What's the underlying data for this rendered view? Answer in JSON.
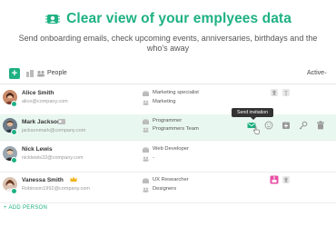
{
  "hero": {
    "title": "Clear view of your emplyees data",
    "subtitle": "Send onboarding emails, check upcoming events, anniversaries, birthdays and the who's away"
  },
  "toolbar": {
    "add_label": "+",
    "people_label": "People",
    "filter_value": "Active"
  },
  "employees": [
    {
      "name": "Alice Smith",
      "email": "alice@company.com",
      "role": "Marketing specialist",
      "team": "Marketing",
      "status": "online"
    },
    {
      "name": "Mark Jackson",
      "email": "jacksonmark@company.com",
      "role": "Programmer",
      "team": "Programmers Team",
      "status": "online"
    },
    {
      "name": "Nick Lewis",
      "email": "nicklewis32@company.com",
      "role": "Web Developer",
      "team": "-",
      "status": "online"
    },
    {
      "name": "Vanessa Smith",
      "email": "Robinson1992@company.com",
      "role": "UX Researcher",
      "team": "Designers",
      "status": "online"
    }
  ],
  "tooltip": "Send invitation",
  "footer": {
    "add_person": "+ ADD PERSON"
  },
  "colors": {
    "accent": "#1eb182",
    "highlight": "#e9f7f1",
    "badge_pink": "#e84fa5"
  }
}
